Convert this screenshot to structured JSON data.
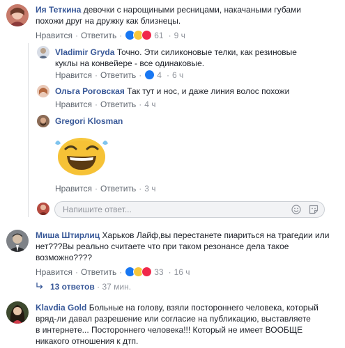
{
  "comments": [
    {
      "author": "Ия Теткина",
      "text_lines": [
        "девочки с нарощиными ресницами, накачаными губами",
        "похожи друг на дружку как близнецы."
      ],
      "like": "Нравится",
      "reply": "Ответить",
      "reactions_count": "61",
      "time": "9 ч",
      "replies": [
        {
          "author": "Vladimir Gryda",
          "text_lines": [
            "Точно. Эти силиконовые телки, как резиновые",
            "куклы на конвейере - все одинаковые."
          ],
          "like": "Нравится",
          "reply": "Ответить",
          "reactions_count": "4",
          "time": "6 ч"
        },
        {
          "author": "Ольга Роговская",
          "text_lines": [
            "Так тут и нос, и даже линия волос похожи"
          ],
          "like": "Нравится",
          "reply": "Ответить",
          "time": "4 ч"
        },
        {
          "author": "Gregori Klosman",
          "sticker": "laughing-sticker",
          "like": "Нравится",
          "reply": "Ответить",
          "time": "3 ч"
        }
      ],
      "reply_input": {
        "placeholder": "Напишите ответ..."
      }
    },
    {
      "author": "Миша Штирлиц",
      "text_lines": [
        "Харьков Лайф,вы перестанете пиариться на трагедии или",
        "нет???Вы реально считаете что при таком резонансе дела такое",
        "возможно????"
      ],
      "like": "Нравится",
      "reply": "Ответить",
      "reactions_count": "33",
      "time": "16 ч",
      "more_replies": "13 ответов",
      "more_replies_time": "37 мин."
    },
    {
      "author": "Klavdia Gold",
      "text_lines": [
        "Больные на голову, взяли постороннего человека, который",
        "вряд-ли давал разрешение или согласие на публикацию, выставляете",
        "в интернете... Постороннего человека!!! Который не имеет ВООБЩЕ",
        "никакого отношения к дтп."
      ]
    }
  ],
  "colors": {
    "link": "#385898",
    "meta": "#90949c",
    "like": "#1877f2",
    "haha": "#f7c73d",
    "love": "#f0284a"
  }
}
